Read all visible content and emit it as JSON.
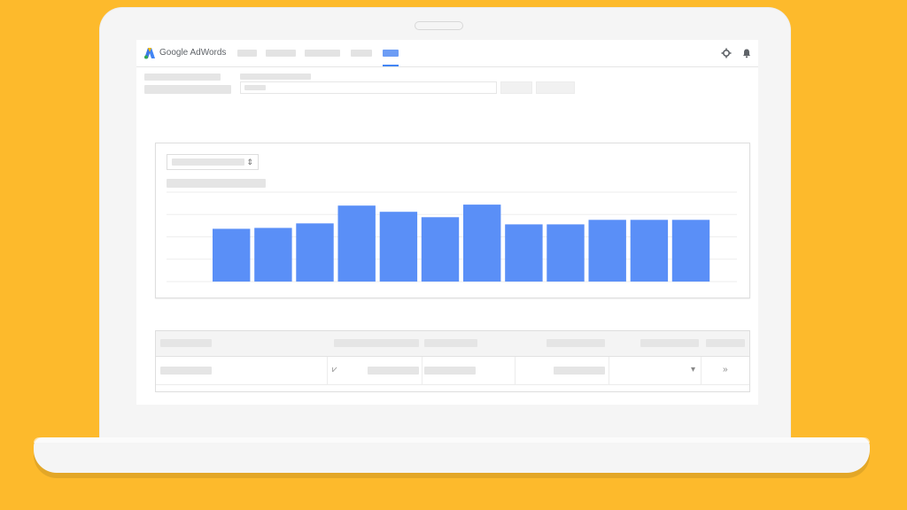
{
  "colors": {
    "background": "#FDBA2C",
    "laptop_body": "#F5F5F5",
    "screen_bg": "#FFFFFF",
    "bar_blue": "#5A8FF7",
    "accent_blue": "#4285F4",
    "placeholder_gray": "#E3E3E3"
  },
  "header": {
    "logo_icon": "adwords-logo-icon",
    "app_name": "Google AdWords",
    "nav_tabs_count_visible": 5,
    "active_tab_index": 4,
    "settings_icon": "gear-icon",
    "notifications_icon": "bell-icon"
  },
  "chart_data": {
    "type": "bar",
    "series": [
      {
        "values": [
          59,
          60,
          65,
          85,
          78,
          72,
          86,
          64,
          64,
          69,
          69,
          69
        ]
      }
    ],
    "ylim": [
      0,
      100
    ],
    "grid": true
  },
  "table": {
    "row_icon": "chart-icon",
    "row_dropdown_icon": "caret-down-icon",
    "row_action_icon": "chevron-right-icon",
    "row_action_text": "»",
    "caret_text": "▾",
    "chart_icon_text": "⩗"
  },
  "dropdown": {
    "arrow_text": "⇕"
  }
}
